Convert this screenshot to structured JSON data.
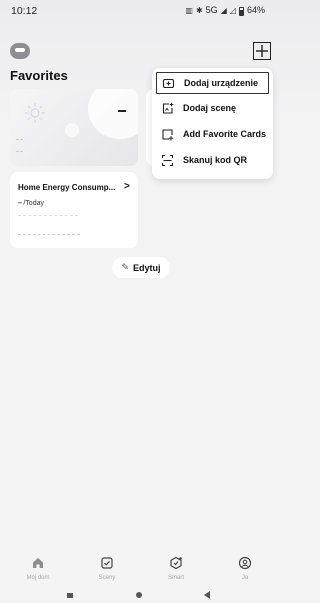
{
  "status_bar": {
    "time": "10:12",
    "network": "5G",
    "battery": "64%"
  },
  "header": {
    "title": "Favorites"
  },
  "weather_card": {
    "value": "–",
    "line1": "--",
    "line2": "--"
  },
  "energy_card": {
    "title": "Home Energy Consump...",
    "value_dash": "–",
    "value_unit": " /Today"
  },
  "edit_button": {
    "label": "Edytuj"
  },
  "dropdown": {
    "items": [
      {
        "label": "Dodaj urządzenie",
        "icon": "add-device-icon"
      },
      {
        "label": "Dodaj scenę",
        "icon": "add-scene-icon"
      },
      {
        "label": "Add Favorite Cards",
        "icon": "add-card-icon"
      },
      {
        "label": "Skanuj kod QR",
        "icon": "scan-qr-icon"
      }
    ]
  },
  "bottom_nav": {
    "items": [
      {
        "label": "Mój dom",
        "icon": "home-icon"
      },
      {
        "label": "Sceny",
        "icon": "scenes-icon"
      },
      {
        "label": "Smart",
        "icon": "smart-icon"
      },
      {
        "label": "Ja",
        "icon": "profile-icon"
      }
    ]
  },
  "colors": {
    "background": "#f3f3f4",
    "card": "#ffffff",
    "text": "#111111",
    "muted": "#a8a8aa"
  }
}
